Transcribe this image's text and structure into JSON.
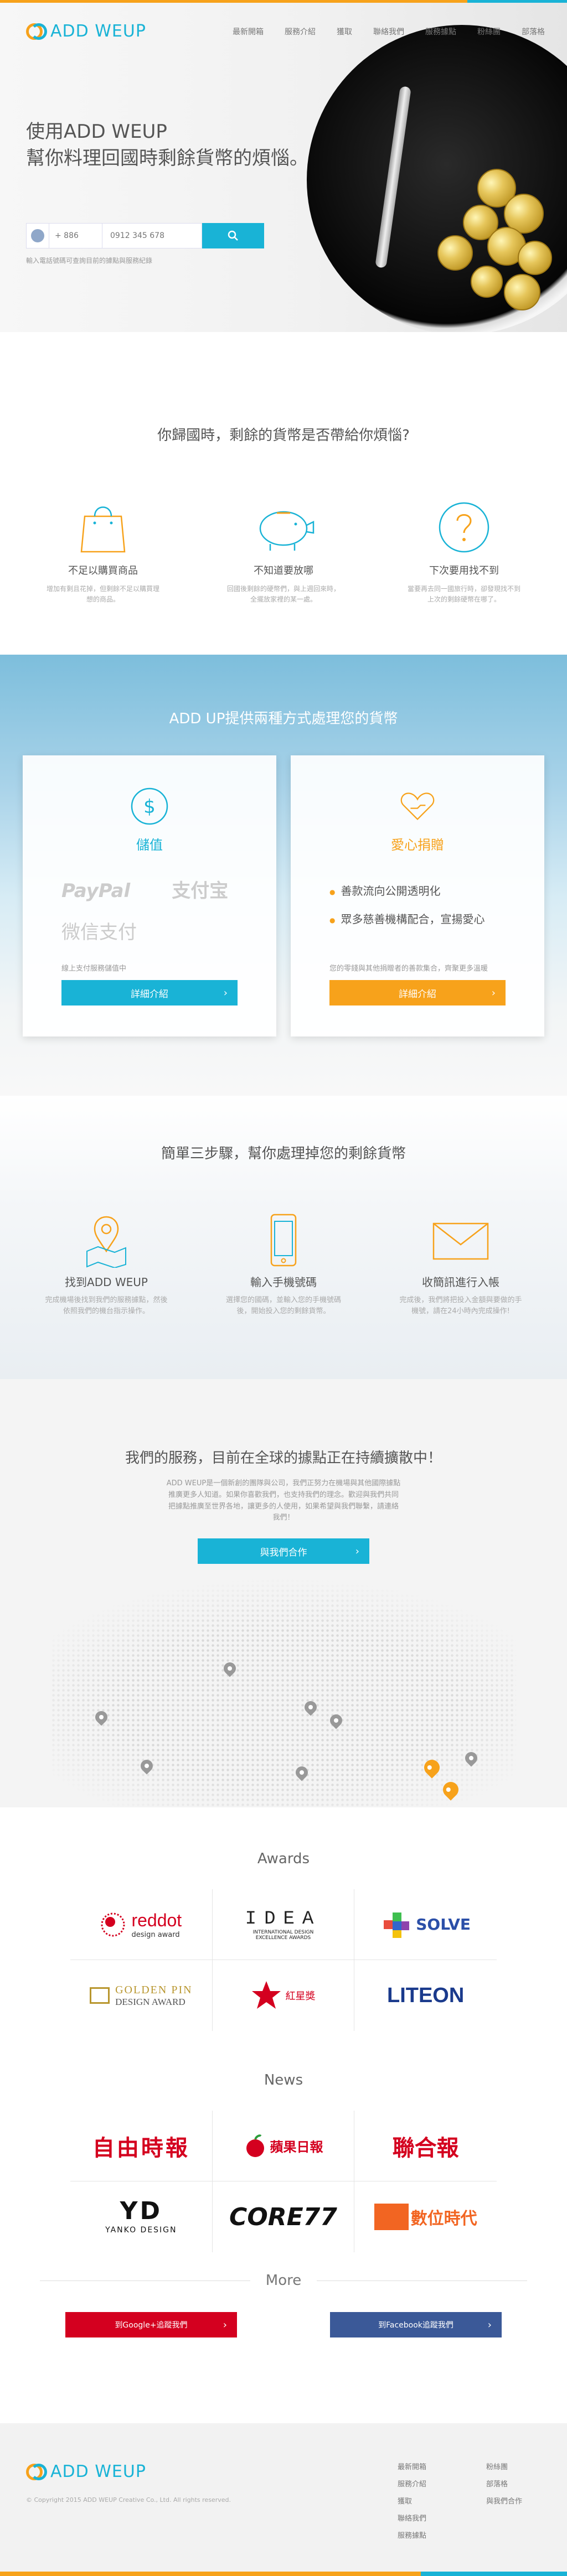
{
  "brand": {
    "name": "ADD WEUP",
    "colors": {
      "orange": "#f7a21b",
      "blue": "#19b3d6",
      "red": "#d4001f",
      "fb": "#3b5998"
    }
  },
  "nav": [
    "最新開箱",
    "服務介紹",
    "獲取",
    "聯絡我們",
    "服務據點",
    "粉絲團",
    "部落格"
  ],
  "hero": {
    "title_line1": "使用ADD WEUP",
    "title_line2": "幫你料理回國時剩餘貨幣的煩惱。",
    "country_code_placeholder": "+ 886",
    "phone_placeholder": "0912 345 678",
    "hint": "輸入電話號碼可查詢目前的據點與服務紀錄",
    "search_icon": "search-icon"
  },
  "worry": {
    "title": "你歸國時，剩餘的貨幣是否帶給你煩惱?",
    "items": [
      {
        "icon": "shopping-bag-icon",
        "title": "不足以購買商品",
        "desc": "增加有剩且花掉，但剩餘不足以購買理想的商品。"
      },
      {
        "icon": "piggy-bank-icon",
        "title": "不知道要放哪",
        "desc": "回國後剩餘的硬幣們，與上週回來時，全擺放家裡的某一處。"
      },
      {
        "icon": "question-icon",
        "title": "下次要用找不到",
        "desc": "當要再去同一國旅行時，卻發現找不到上次的剩餘硬幣在哪了。"
      }
    ]
  },
  "ways": {
    "title": "ADD UP提供兩種方式處理您的貨幣",
    "save": {
      "icon": "dollar-icon",
      "title": "儲值",
      "brands": [
        "PayPal",
        "支付宝",
        "微信支付"
      ],
      "note": "線上支付服務儲值中",
      "button": "詳細介紹"
    },
    "donate": {
      "icon": "heart-hand-icon",
      "title": "愛心捐贈",
      "bullets": [
        "善款流向公開透明化",
        "眾多慈善機構配合，宣揚愛心"
      ],
      "note": "您的零錢與其他捐贈者的善款集合，齊聚更多溫暖",
      "button": "詳細介紹"
    }
  },
  "steps": {
    "title": "簡單三步驟，幫你處理掉您的剩餘貨幣",
    "items": [
      {
        "icon": "map-pin-icon",
        "title": "找到ADD WEUP",
        "desc": "完成機場後找到我們的服務據點，然後依照我們的機台指示操作。"
      },
      {
        "icon": "phone-icon",
        "title": "輸入手機號碼",
        "desc": "選擇您的國碼，並輸入您的手機號碼後，開始投入您的剩餘貨幣。"
      },
      {
        "icon": "mail-icon",
        "title": "收簡訊進行入帳",
        "desc": "完成後，我們將把投入金額與要做的手機號，請在24小時內完成操作!"
      }
    ]
  },
  "service": {
    "title": "我們的服務，目前在全球的據點正在持續擴散中！",
    "desc": "ADD WEUP是一個新創的團隊與公司，我們正努力在機場與其他國際據點推廣更多人知道。如果你喜歡我們，也支持我們的理念。歡迎與我們共同把據點推廣至世界各地，讓更多的人使用，如果希望與我們聯繫，請連絡我們！",
    "button": "與我們合作"
  },
  "awards": {
    "title": "Awards",
    "items": [
      {
        "name": "reddot",
        "line2": "design award"
      },
      {
        "name": "IDEA",
        "line2": "INTERNATIONAL DESIGN EXCELLENCE AWARDS"
      },
      {
        "name": "SOLVE",
        "line2": ""
      },
      {
        "name": "GOLDEN PIN",
        "line2": "DESIGN AWARD"
      },
      {
        "name": "紅星獎",
        "line2": ""
      },
      {
        "name": "LITEON",
        "line2": ""
      }
    ]
  },
  "news": {
    "title": "News",
    "items": [
      {
        "name": "自由時報",
        "line2": ""
      },
      {
        "name": "蘋果日報",
        "line2": ""
      },
      {
        "name": "聯合報",
        "line2": ""
      },
      {
        "name": "YD",
        "line2": "YANKO DESIGN"
      },
      {
        "name": "CORE77",
        "line2": ""
      },
      {
        "name": "數位時代",
        "line2": ""
      }
    ]
  },
  "more": {
    "title": "More",
    "google_button": "到Google+追蹤我們",
    "facebook_button": "到Facebook追蹤我們"
  },
  "footer": {
    "copyright": "© Copyright 2015 ADD WEUP Creative Co., Ltd. All rights reserved.",
    "links": [
      "最新開箱",
      "粉絲團",
      "服務介紹",
      "部落格",
      "獲取",
      "與我們合作",
      "聯絡我們",
      "",
      "服務據點",
      ""
    ]
  }
}
